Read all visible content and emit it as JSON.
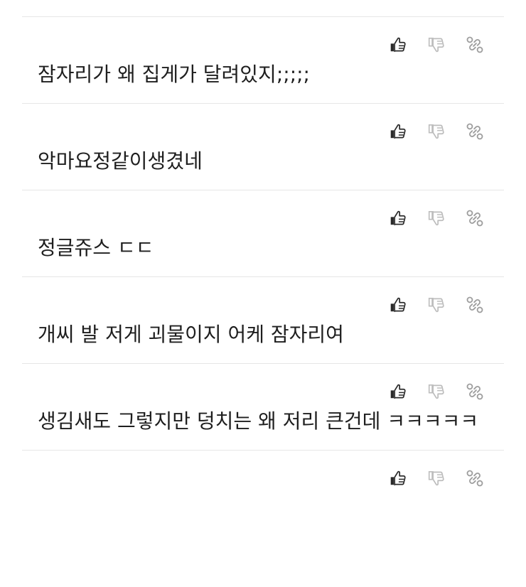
{
  "colors": {
    "divider": "#e6e6e6",
    "like_icon": "#2b2b2b",
    "dislike_icon": "#bdbdbd",
    "link_icon": "#9e9e9e",
    "text": "#1e1e1e"
  },
  "comments": [
    {
      "text": "잠자리가 왜 집게가 달려있지;;;;;"
    },
    {
      "text": "악마요정같이생겼네"
    },
    {
      "text": "정글쥬스 ㄷㄷ"
    },
    {
      "text": "개씨 발 저게 괴물이지 어케 잠자리여"
    },
    {
      "text": "생김새도 그렇지만 덩치는 왜 저리 큰건데 ㅋㅋㅋㅋㅋ"
    }
  ],
  "icons": {
    "like": "thumbs-up-icon",
    "dislike": "thumbs-down-icon",
    "link": "link-icon"
  }
}
